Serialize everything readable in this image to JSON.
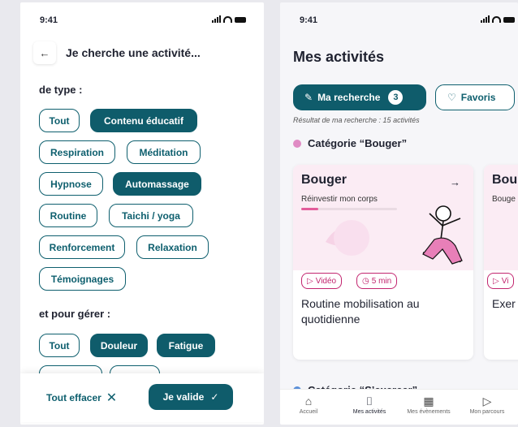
{
  "status": {
    "time": "9:41"
  },
  "left": {
    "header_title": "Je cherche une activité...",
    "type_label": "de type :",
    "type_chips": [
      {
        "label": "Tout",
        "selected": false
      },
      {
        "label": "Contenu éducatif",
        "selected": true
      },
      {
        "label": "Respiration",
        "selected": false
      },
      {
        "label": "Méditation",
        "selected": false
      },
      {
        "label": "Hypnose",
        "selected": false
      },
      {
        "label": "Automassage",
        "selected": true
      },
      {
        "label": "Routine",
        "selected": false
      },
      {
        "label": "Taichi / yoga",
        "selected": false
      },
      {
        "label": "Renforcement",
        "selected": false
      },
      {
        "label": "Relaxation",
        "selected": false
      },
      {
        "label": "Témoignages",
        "selected": false
      }
    ],
    "manage_label": "et pour gérer :",
    "manage_chips": [
      {
        "label": "Tout",
        "selected": false
      },
      {
        "label": "Douleur",
        "selected": true
      },
      {
        "label": "Fatigue",
        "selected": true
      }
    ],
    "clear_label": "Tout effacer",
    "validate_label": "Je valide"
  },
  "right": {
    "title": "Mes activités",
    "search_label": "Ma recherche",
    "search_count": "3",
    "favorites_label": "Favoris",
    "result_text": "Résultat de ma recherche : 15 activités",
    "category1": "Catégorie “Bouger”",
    "category2": "Catégorie “S’exercer”",
    "card1": {
      "title": "Bouger",
      "subtitle": "Réinvestir mon corps",
      "progress": 0.18,
      "tag_video": "Vidéo",
      "tag_time": "5 min",
      "description": "Routine mobilisation au quotidienne"
    },
    "card2": {
      "title": "Bou",
      "subtitle": "Bouge",
      "tag_video": "Vi",
      "description": "Exer"
    },
    "tabs": [
      "Accueil",
      "Mes activités",
      "Mes évènements",
      "Mon parcours"
    ],
    "colors": {
      "primary": "#0f5c6b",
      "accent": "#e35c9b",
      "bouger_dot": "#e08bc4",
      "exercer_dot": "#5a8fd8"
    }
  }
}
